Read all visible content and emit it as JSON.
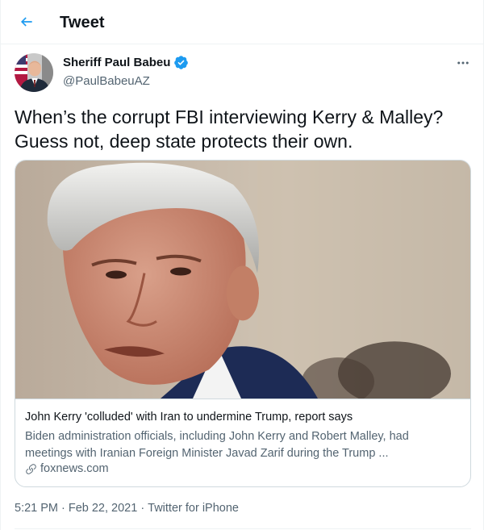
{
  "header": {
    "title": "Tweet",
    "back_icon": "arrow-left-icon",
    "accent_color": "#1d9bf0"
  },
  "author": {
    "name": "Sheriff Paul Babeu",
    "handle": "@PaulBabeuAZ",
    "verified": true,
    "verified_icon": "verified-badge-icon"
  },
  "more_icon": "more-horizontal-icon",
  "tweet": {
    "line1": "When’s the corrupt FBI interviewing Kerry & Malley?",
    "line2": "Guess not, deep state protects their own."
  },
  "link_card": {
    "title": "John Kerry 'colluded' with Iran to undermine Trump, report says",
    "description_line1": "Biden administration officials, including John Kerry and Robert Malley, had",
    "description_line2": "meetings with Iranian Foreign Minister Javad Zarif during the Trump ...",
    "domain": "foxnews.com",
    "link_icon": "link-icon"
  },
  "meta": {
    "time": "5:21 PM",
    "separator1": "·",
    "date": "Feb 22, 2021",
    "separator2": "·",
    "source": "Twitter for iPhone"
  }
}
